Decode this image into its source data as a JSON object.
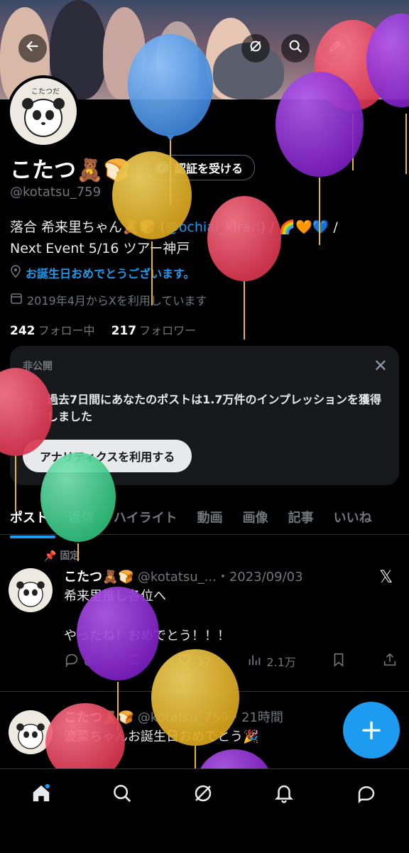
{
  "header": {
    "back_icon": "arrow-left-icon",
    "grok_icon": "grok-icon",
    "search_icon": "search-icon",
    "edit_icon": "pencil-icon"
  },
  "profile": {
    "name": "こたつ🧸🍞",
    "verify_label": "認証を受ける",
    "handle": "@kotatsu_759",
    "bio_before": "落合 希来里ちゃん🧸🍞 (",
    "bio_mention": "@ochiai_kirari",
    "bio_after": ") / 🌈🧡💙 /",
    "bio_line2": "Next Event 5/16 ツアー神戸",
    "birthday": "お誕生日おめでとうございます。",
    "joined": "2019年4月からXを利用しています",
    "following_count": "242",
    "following_label": "フォロー中",
    "followers_count": "217",
    "followers_label": "フォロワー"
  },
  "card": {
    "tag": "非公開",
    "text": "過去7日間にあなたのポストは1.7万件のインプレッションを獲得しました",
    "button": "アナリティクスを利用する"
  },
  "tabs": [
    "ポスト",
    "返信",
    "ハイライト",
    "動画",
    "画像",
    "記事",
    "いいね"
  ],
  "posts": [
    {
      "pinned_label": "固定",
      "name": "こたつ🧸🍞",
      "meta": "@kotatsu_...・2023/09/03",
      "line1": "希来里推し各位へ",
      "line2": "やったね！おめでとう！！！",
      "replies": "6",
      "likes": "37",
      "views": "2.1万"
    },
    {
      "name": "こたつ🧸🍞",
      "meta": "@kotatsu_759・21時間",
      "line1": "波菜ちゃんお誕生日おめでとう🎉"
    }
  ],
  "colors": {
    "accent": "#1d9bf0",
    "balloon_blue": "#4a90e2",
    "balloon_red": "#e0435a",
    "balloon_purple": "#8e2fd1",
    "balloon_yellow": "#e6b82e",
    "balloon_green": "#3ecf8e"
  }
}
